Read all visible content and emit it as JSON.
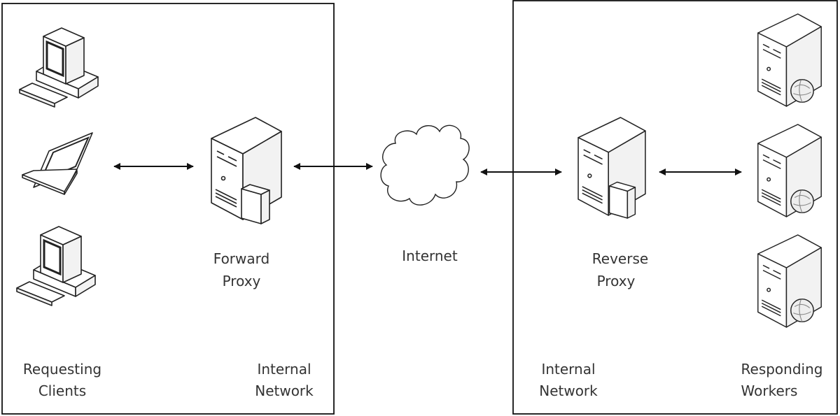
{
  "diagram": {
    "left_zone": {
      "clients_label": [
        "Requesting",
        "Clients"
      ],
      "network_label": [
        "Internal",
        "Network"
      ]
    },
    "forward_proxy": {
      "label": [
        "Forward",
        "Proxy"
      ],
      "icon": "server-with-box-icon"
    },
    "internet": {
      "label": "Internet",
      "icon": "cloud-icon"
    },
    "reverse_proxy": {
      "label": [
        "Reverse",
        "Proxy"
      ],
      "icon": "server-with-box-icon"
    },
    "right_zone": {
      "network_label": [
        "Internal",
        "Network"
      ],
      "workers_label": [
        "Responding",
        "Workers"
      ]
    },
    "clients": [
      "desktop-computer-icon",
      "laptop-icon",
      "desktop-computer-icon"
    ],
    "workers": [
      "web-server-icon",
      "web-server-icon",
      "web-server-icon"
    ],
    "connections": [
      "clients-forward-proxy",
      "forward-proxy-internet",
      "internet-reverse-proxy",
      "reverse-proxy-workers"
    ],
    "colors": {
      "line": "#222222",
      "text": "#333333",
      "background": "#ffffff"
    }
  }
}
